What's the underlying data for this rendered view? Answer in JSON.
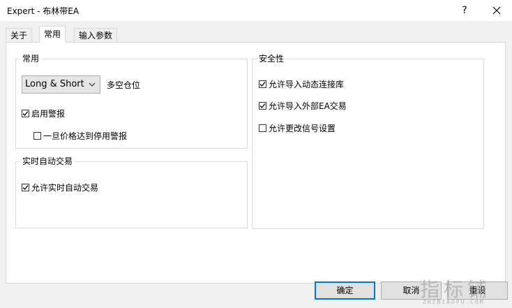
{
  "window": {
    "title": "Expert - 布林带EA",
    "help_label": "?"
  },
  "tabs": [
    {
      "label": "关于"
    },
    {
      "label": "常用"
    },
    {
      "label": "输入参数"
    }
  ],
  "common": {
    "group_title": "常用",
    "direction_select": {
      "value": "Long & Short"
    },
    "direction_label": "多空仓位",
    "enable_alerts": {
      "label": "启用警报",
      "checked": true
    },
    "disable_alert_on_price": {
      "label": "一旦价格达到停用警报",
      "checked": false
    }
  },
  "live_trading": {
    "group_title": "实时自动交易",
    "allow_live": {
      "label": "允许实时自动交易",
      "checked": true
    }
  },
  "security": {
    "group_title": "安全性",
    "allow_dll": {
      "label": "允许导入动态连接库",
      "checked": true
    },
    "allow_external_ea": {
      "label": "允许导入外部EA交易",
      "checked": true
    },
    "allow_signal_change": {
      "label": "允许更改信号设置",
      "checked": false
    }
  },
  "buttons": {
    "ok": "确定",
    "cancel": "取消",
    "reset": "重设"
  },
  "watermark": {
    "text": "指标铺",
    "sub": "ZHIBIAOPU.COM"
  }
}
